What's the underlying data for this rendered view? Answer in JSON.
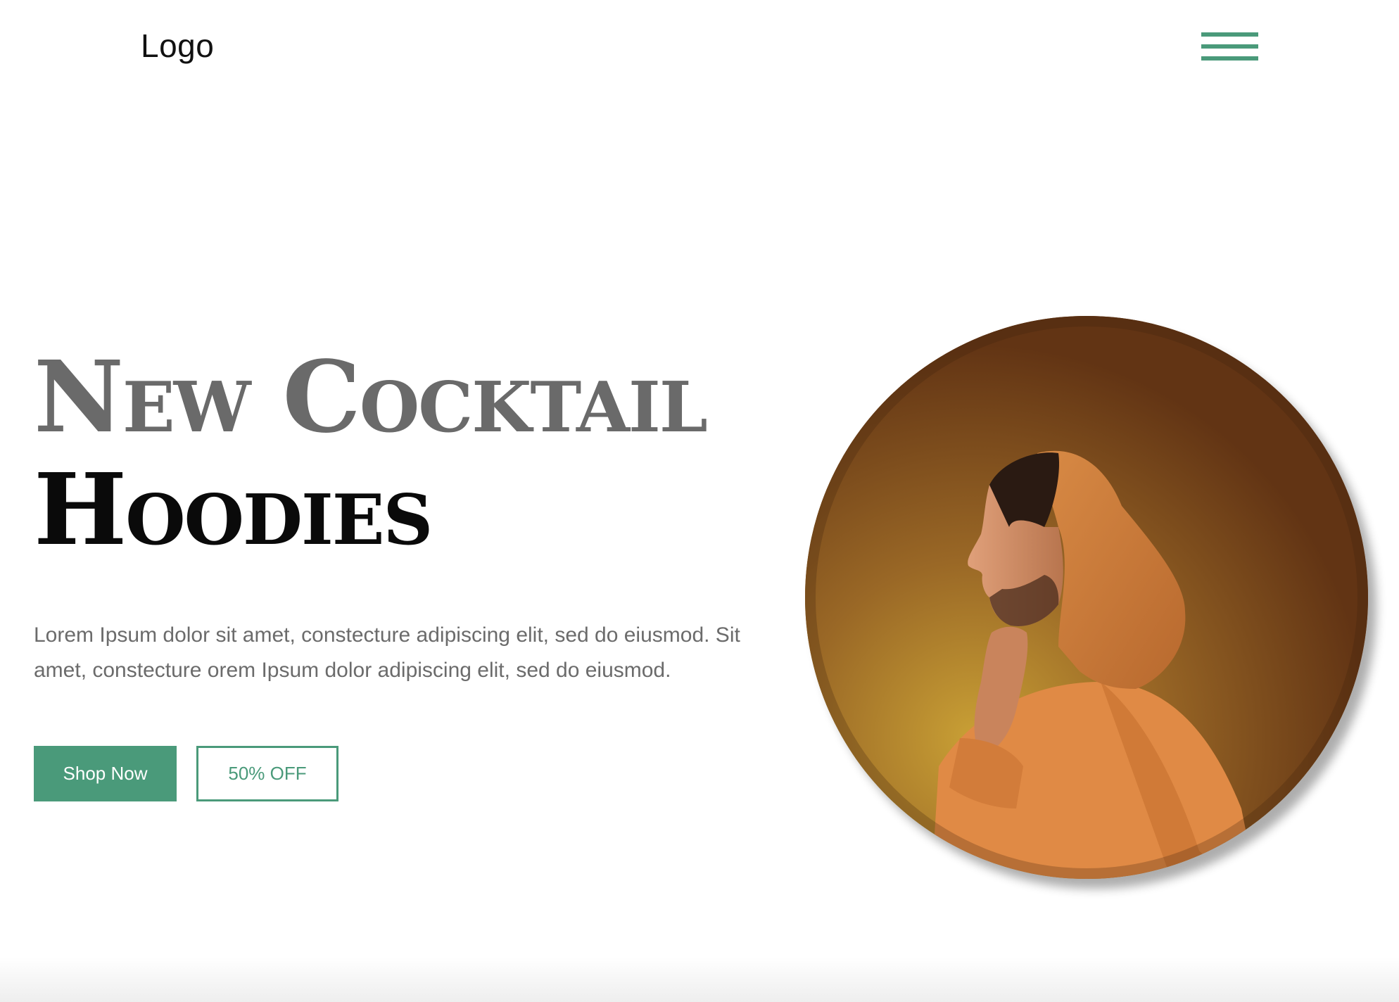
{
  "header": {
    "logo_text": "Logo",
    "menu_icon": "hamburger-menu-icon"
  },
  "hero": {
    "headline_line1": "New Cocktail",
    "headline_line2": "Hoodies",
    "description": "Lorem Ipsum dolor sit amet, constecture adipiscing elit, sed do eiusmod. Sit amet, constecture orem Ipsum dolor adipiscing elit, sed do eiusmod.",
    "primary_button_label": "Shop Now",
    "secondary_button_label": "50% OFF",
    "image_description": "hooded-man-profile-photo"
  },
  "colors": {
    "accent": "#4a9a7a",
    "headline_gray": "#6a6a6a",
    "headline_black": "#0a0a0a",
    "body_text": "#6b6b6b"
  }
}
